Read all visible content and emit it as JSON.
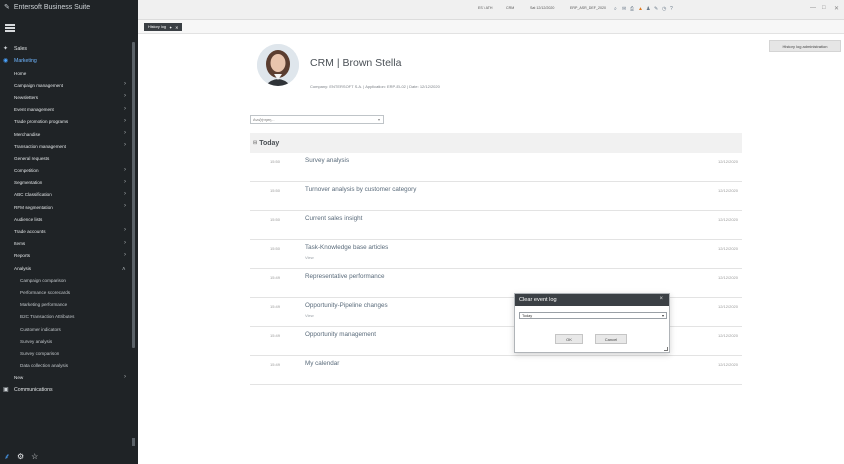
{
  "app": {
    "title": "Entersoft Business Suite"
  },
  "topbar": {
    "items": [
      "ES \\ ATH",
      "CRM",
      "Sat 12/12/2020",
      "ERP_ASR_DEF_2020"
    ],
    "window_controls": [
      "—",
      "□",
      "✕"
    ]
  },
  "tab": {
    "label": "History log",
    "pin": "✦",
    "close": "✕"
  },
  "sidebar": {
    "sales": "Sales",
    "marketing": "Marketing",
    "items": [
      "Home",
      "Campaign management",
      "Newsletters",
      "Event management",
      "Trade promotion programs",
      "Merchandise",
      "Transaction management",
      "General requests",
      "Competition",
      "Segmentation",
      "ABC Classification",
      "RFM segmentation",
      "Audience lists",
      "Trade accounts",
      "Items",
      "Reports",
      "Analysis"
    ],
    "analysis_subitems": [
      "Campaign comparison",
      "Performance scorecards",
      "Marketing performance",
      "B2C Transaction Attributes",
      "Customer indicators",
      "Survey analysis",
      "Survey comparison",
      "Data collection analysis"
    ],
    "new": "New",
    "communications": "Communications",
    "bottom_icons": [
      "sitemap-icon",
      "gear-icon",
      "star-icon"
    ]
  },
  "main": {
    "admin_button": "History log administration",
    "profile_title": "CRM | Brown Stella",
    "profile_meta": "Company: ENTERSOFT S.A. | Application: ERP-EL02 | Date: 12/12/2020",
    "filter_placeholder": "Αναζήτηση...",
    "group_label": "Today",
    "rows": [
      {
        "time": "15:50",
        "title": "Survey analysis",
        "view": "",
        "date": "12/12/2020"
      },
      {
        "time": "15:50",
        "title": "Turnover analysis by customer category",
        "view": "",
        "date": "12/12/2020"
      },
      {
        "time": "15:50",
        "title": "Current sales insight",
        "view": "",
        "date": "12/12/2020"
      },
      {
        "time": "15:50",
        "title": "Task-Knowledge base articles",
        "view": "View",
        "date": "12/12/2020"
      },
      {
        "time": "15:49",
        "title": "Representative performance",
        "view": "",
        "date": "12/12/2020"
      },
      {
        "time": "15:49",
        "title": "Opportunity-Pipeline changes",
        "view": "View",
        "date": "12/12/2020"
      },
      {
        "time": "15:49",
        "title": "Opportunity management",
        "view": "",
        "date": "12/12/2020"
      },
      {
        "time": "15:49",
        "title": "My calendar",
        "view": "",
        "date": "12/12/2020"
      }
    ]
  },
  "dialog": {
    "title": "Clear event log",
    "selected": "Today",
    "ok": "OK",
    "cancel": "Cancel"
  }
}
